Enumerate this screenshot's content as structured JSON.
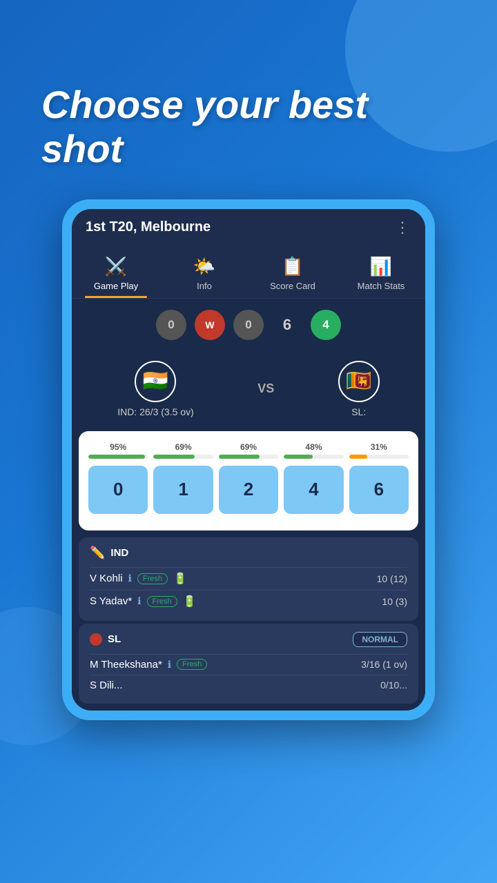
{
  "hero": {
    "text": "Choose your best shot"
  },
  "match": {
    "title": "1st T20, Melbourne",
    "more_icon": "⋮"
  },
  "nav": {
    "tabs": [
      {
        "id": "gameplay",
        "label": "Game Play",
        "icon": "⚔️",
        "active": true
      },
      {
        "id": "info",
        "label": "Info",
        "icon": "🌤️",
        "active": false
      },
      {
        "id": "scorecard",
        "label": "Score Card",
        "icon": "📋",
        "active": false
      },
      {
        "id": "matchstats",
        "label": "Match Stats",
        "icon": "📊",
        "active": false
      }
    ]
  },
  "balls": [
    {
      "label": "0",
      "type": "grey"
    },
    {
      "label": "W",
      "type": "red"
    },
    {
      "label": "0",
      "type": "grey"
    },
    {
      "label": "6",
      "type": "plain"
    },
    {
      "label": "4",
      "type": "green"
    }
  ],
  "teams": {
    "home": {
      "name": "IND",
      "flag": "🇮🇳",
      "score": "IND: 26/3 (3.5 ov)"
    },
    "vs": "VS",
    "away": {
      "name": "SL",
      "flag": "🇱🇰",
      "score": "SL:"
    }
  },
  "shots": [
    {
      "value": "0",
      "pct": "95%",
      "bar_pct": 95,
      "color": "#4caf50"
    },
    {
      "value": "1",
      "pct": "69%",
      "bar_pct": 69,
      "color": "#4caf50"
    },
    {
      "value": "2",
      "pct": "69%",
      "bar_pct": 69,
      "color": "#4caf50"
    },
    {
      "value": "4",
      "pct": "48%",
      "bar_pct": 48,
      "color": "#4caf50"
    },
    {
      "value": "6",
      "pct": "31%",
      "bar_pct": 31,
      "color": "#ff9800"
    }
  ],
  "ind_players": {
    "team": "IND",
    "players": [
      {
        "name": "V Kohli",
        "badge": "Fresh",
        "score": "10 (12)"
      },
      {
        "name": "S Yadav*",
        "badge": "Fresh",
        "score": "10 (3)"
      }
    ]
  },
  "sl_players": {
    "team": "SL",
    "mode": "NORMAL",
    "players": [
      {
        "name": "M Theekshana*",
        "badge": "Fresh",
        "score": "3/16 (1 ov)"
      },
      {
        "name": "S Dili...",
        "badge": "",
        "score": "0/10..."
      }
    ]
  }
}
